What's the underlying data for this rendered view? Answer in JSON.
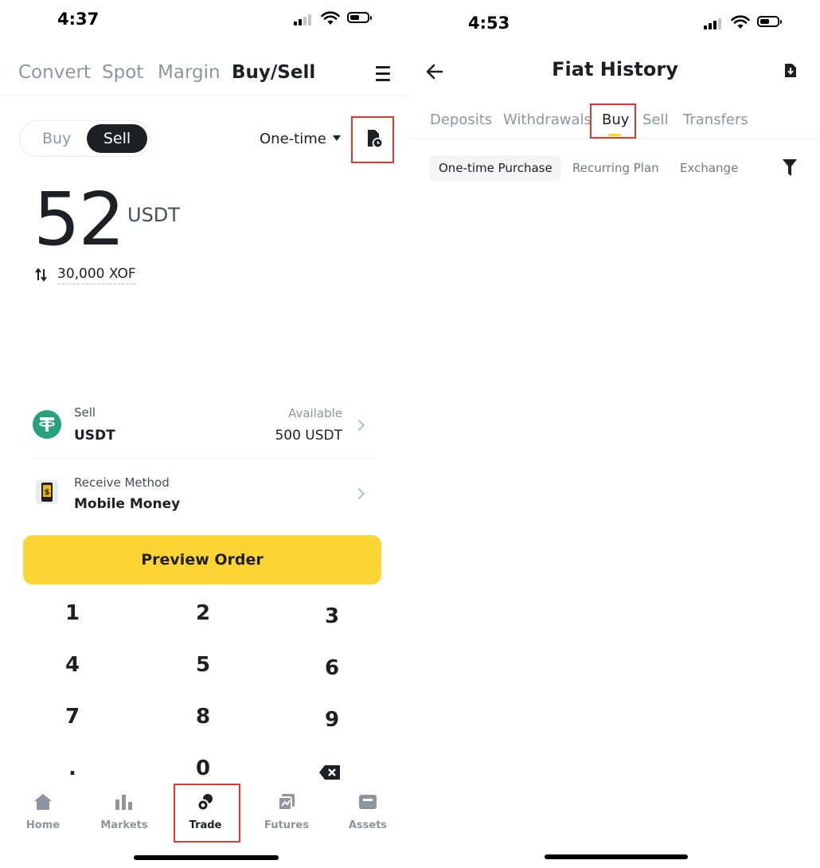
{
  "left": {
    "status": {
      "time": "4:37"
    },
    "header_tabs": [
      {
        "label": "Convert"
      },
      {
        "label": "Spot"
      },
      {
        "label": "Margin"
      },
      {
        "label": "Buy/Sell"
      }
    ],
    "mode_toggle": {
      "buy_label": "Buy",
      "sell_label": "Sell",
      "selected": "Sell"
    },
    "frequency": {
      "label": "One-time"
    },
    "amount": {
      "value": "52",
      "unit": "USDT",
      "converted": "30,000 XOF"
    },
    "sell_row": {
      "label": "Sell",
      "asset": "USDT",
      "available_label": "Available",
      "available_value": "500 USDT"
    },
    "receive_row": {
      "label": "Receive Method",
      "value": "Mobile Money"
    },
    "preview_button": {
      "label": "Preview Order"
    },
    "keypad": [
      "1",
      "2",
      "3",
      "4",
      "5",
      "6",
      "7",
      "8",
      "9",
      ".",
      "0"
    ],
    "bottom_nav": [
      {
        "label": "Home",
        "icon": "home-icon"
      },
      {
        "label": "Markets",
        "icon": "markets-icon"
      },
      {
        "label": "Trade",
        "icon": "trade-icon",
        "active": true
      },
      {
        "label": "Futures",
        "icon": "futures-icon"
      },
      {
        "label": "Assets",
        "icon": "assets-icon"
      }
    ]
  },
  "right": {
    "status": {
      "time": "4:53"
    },
    "title": "Fiat History",
    "tabs": [
      {
        "label": "Deposits"
      },
      {
        "label": "Withdrawals"
      },
      {
        "label": "Buy",
        "active": true
      },
      {
        "label": "Sell"
      },
      {
        "label": "Transfers"
      }
    ],
    "filters": [
      {
        "label": "One-time Purchase",
        "active": true
      },
      {
        "label": "Recurring Plan"
      },
      {
        "label": "Exchange"
      }
    ]
  },
  "colors": {
    "accent": "#fcd535",
    "highlight": "#e0392b",
    "text": "#1e2026",
    "muted": "#8f959e"
  }
}
